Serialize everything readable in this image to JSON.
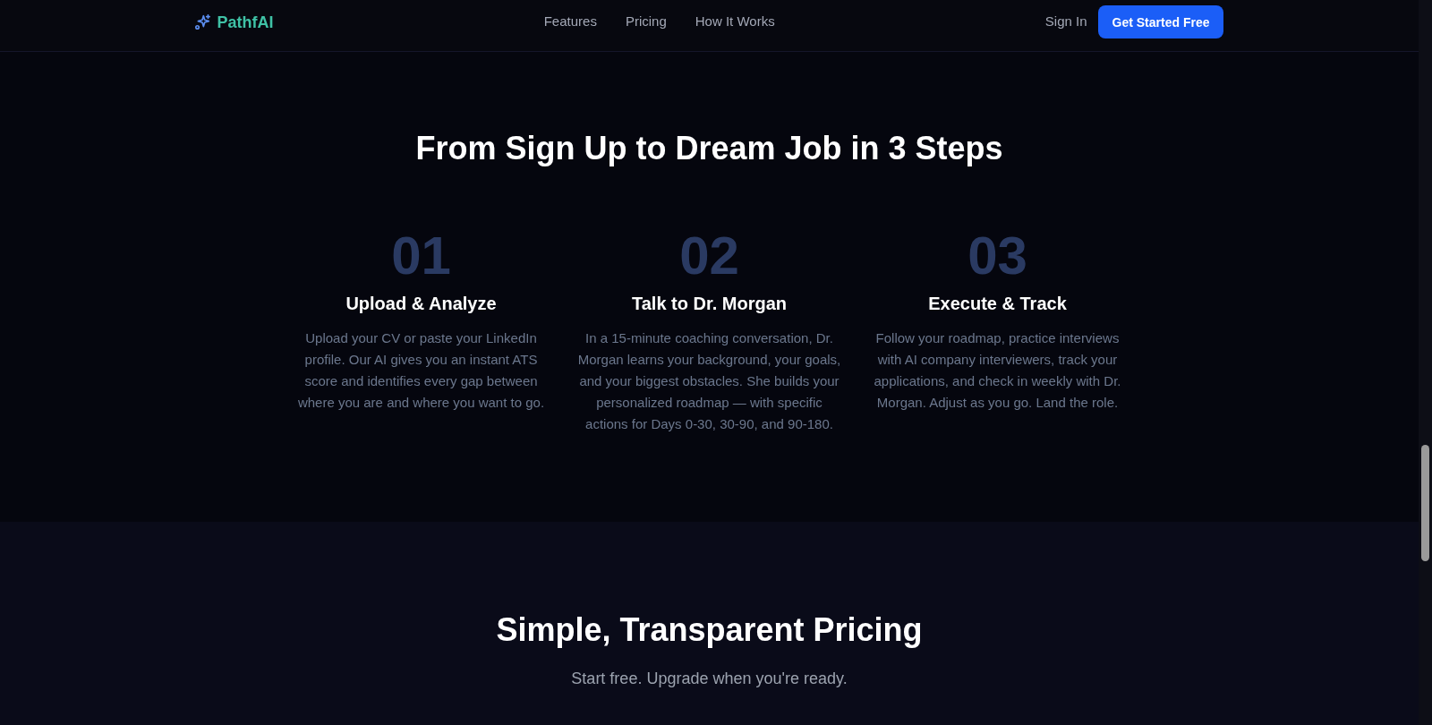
{
  "nav": {
    "logo": "PathfAI",
    "links": [
      "Features",
      "Pricing",
      "How It Works"
    ],
    "sign_in": "Sign In",
    "cta": "Get Started Free"
  },
  "steps_section": {
    "title": "From Sign Up to Dream Job in 3 Steps",
    "steps": [
      {
        "number": "01",
        "title": "Upload & Analyze",
        "description": "Upload your CV or paste your LinkedIn profile. Our AI gives you an instant ATS score and identifies every gap between where you are and where you want to go."
      },
      {
        "number": "02",
        "title": "Talk to Dr. Morgan",
        "description": "In a 15-minute coaching conversation, Dr. Morgan learns your background, your goals, and your biggest obstacles. She builds your personalized roadmap — with specific actions for Days 0-30, 30-90, and 90-180."
      },
      {
        "number": "03",
        "title": "Execute & Track",
        "description": "Follow your roadmap, practice interviews with AI company interviewers, track your applications, and check in weekly with Dr. Morgan. Adjust as you go. Land the role."
      }
    ]
  },
  "pricing_section": {
    "title": "Simple, Transparent Pricing",
    "subtitle": "Start free. Upgrade when you're ready."
  }
}
